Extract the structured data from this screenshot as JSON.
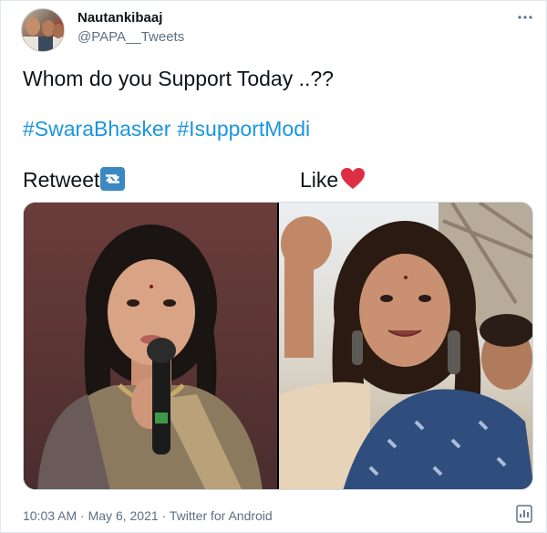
{
  "author": {
    "name": "Nautankibaaj",
    "handle": "@PAPA__Tweets",
    "avatar_icon": "avatar-photo"
  },
  "menu_icon": "more-dots-icon",
  "tweet": {
    "text_line": "Whom do you Support Today ..??",
    "hashtags": [
      "#SwaraBhasker",
      "#IsupportModi"
    ],
    "retweet_label": "Retweet",
    "retweet_icon": "retweet-emoji-icon",
    "like_label": "Like",
    "like_icon": "red-heart-emoji-icon"
  },
  "media": {
    "left_photo": "woman-speaking-into-microphone-photo",
    "right_photo": "smiling-woman-in-blue-saree-photo"
  },
  "footer": {
    "time": "10:03 AM",
    "separator": "·",
    "date": "May 6, 2021",
    "source": "Twitter for Android",
    "analytics_icon": "analytics-icon"
  },
  "colors": {
    "text": "#0f1419",
    "secondary": "#5b7083",
    "link": "#1b95e0",
    "heart": "#dd2e44",
    "retweet_badge": "#3b88c3"
  }
}
